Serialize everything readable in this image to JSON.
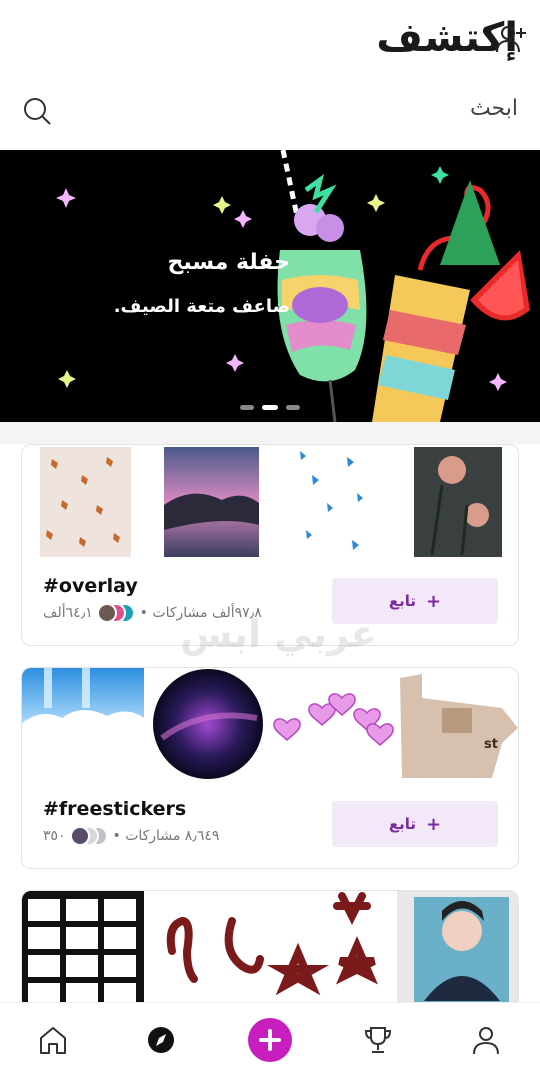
{
  "header": {
    "title": "إكتشف",
    "add_user_icon": "add-user-icon"
  },
  "search": {
    "placeholder": "ابحث",
    "icon": "search-icon"
  },
  "banner": {
    "title": "حفلة مسبح",
    "subtitle": "ضاعف متعة الصيف.",
    "page_index": 2,
    "page_count": 3
  },
  "cards": [
    {
      "tag": "#overlay",
      "shares": "٩٧٫٨ألف مشاركات",
      "followers": "٦٤٫١ألف",
      "follow_label": "تابع"
    },
    {
      "tag": "#freestickers",
      "shares": "٨٫٦٤٩ مشاركات",
      "followers": "٣٥٠",
      "follow_label": "تابع"
    }
  ],
  "watermark": "عربي ابس",
  "nav": {
    "items": [
      "home-icon",
      "explore-icon",
      "create-icon",
      "trophy-icon",
      "profile-icon"
    ],
    "active": "explore-icon"
  },
  "colors": {
    "accent": "#c81ebd",
    "follow_bg": "#f3e8f7",
    "follow_text": "#7b2aa0"
  }
}
